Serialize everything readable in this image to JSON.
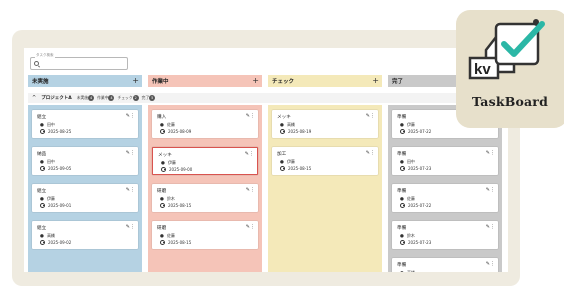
{
  "search": {
    "label": "タスク検索"
  },
  "columns": [
    {
      "title": "未実施",
      "color": "#b5d2e3"
    },
    {
      "title": "作業中",
      "color": "#f5c4b8"
    },
    {
      "title": "チェック",
      "color": "#f4e9b9"
    },
    {
      "title": "完了",
      "color": "#c9c9c9"
    }
  ],
  "add_symbol": "+",
  "project": {
    "name": "プロジェクトA",
    "statuses": [
      {
        "label": "未実施",
        "count": "4"
      },
      {
        "label": "作業中",
        "count": "4"
      },
      {
        "label": "チェック",
        "count": "2"
      },
      {
        "label": "完了",
        "count": "5"
      }
    ]
  },
  "cards": {
    "todo": [
      {
        "title": "組立",
        "person": "田中",
        "date": "2025-08-25"
      },
      {
        "title": "納品",
        "person": "田中",
        "date": "2025-09-05"
      },
      {
        "title": "組立",
        "person": "伊藤",
        "date": "2025-09-01"
      },
      {
        "title": "組立",
        "person": "高橋",
        "date": "2025-09-02"
      }
    ],
    "doing": [
      {
        "title": "購入",
        "person": "佐藤",
        "date": "2025-08-09"
      },
      {
        "title": "メッキ",
        "person": "伊藤",
        "date": "2025-09-00"
      },
      {
        "title": "研磨",
        "person": "鈴木",
        "date": "2025-08-15"
      },
      {
        "title": "研磨",
        "person": "佐藤",
        "date": "2025-08-15"
      }
    ],
    "check": [
      {
        "title": "メッキ",
        "person": "高橋",
        "date": "2025-08-19"
      },
      {
        "title": "加工",
        "person": "伊藤",
        "date": "2025-08-15"
      }
    ],
    "done": [
      {
        "title": "準備",
        "person": "伊藤",
        "date": "2025-07-22"
      },
      {
        "title": "準備",
        "person": "田中",
        "date": "2025-07-23"
      },
      {
        "title": "準備",
        "person": "佐藤",
        "date": "2025-07-22"
      },
      {
        "title": "準備",
        "person": "鈴木",
        "date": "2025-07-23"
      },
      {
        "title": "準備",
        "person": "高橋",
        "date": ""
      }
    ]
  },
  "icons": {
    "pencil": "✎",
    "more": "⋮",
    "person": "👤",
    "chevron": "^"
  },
  "logo": {
    "text": "TaskBoard",
    "badge": "kv",
    "accent": "#2bb7a6"
  }
}
